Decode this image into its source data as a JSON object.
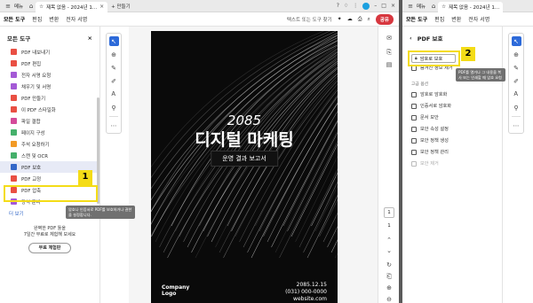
{
  "left": {
    "titlebar": {
      "menu_label": "메뉴",
      "tab_title": "제목 없음 - 2024년 1...",
      "new_tab": "+ 만들기"
    },
    "menubar": {
      "items": [
        "모든 도구",
        "편집",
        "변환",
        "전자 서명"
      ],
      "search_placeholder": "텍스트 또는 도구 찾기",
      "share_label": "공유"
    },
    "tools_panel": {
      "title": "모든 도구",
      "items": [
        {
          "label": "PDF 내보내기",
          "color": "#e94f43"
        },
        {
          "label": "PDF 편집",
          "color": "#e94f43"
        },
        {
          "label": "전자 서명 요청",
          "color": "#a45ad6"
        },
        {
          "label": "채우기 및 서명",
          "color": "#a45ad6"
        },
        {
          "label": "PDF 만들기",
          "color": "#e94f43"
        },
        {
          "label": "이 PDF 스타일화",
          "color": "#e94f43"
        },
        {
          "label": "파일 결합",
          "color": "#d44a9a"
        },
        {
          "label": "페이지 구성",
          "color": "#45b06b"
        },
        {
          "label": "주석 요청하기",
          "color": "#f29a25"
        },
        {
          "label": "스캔 및 OCR",
          "color": "#45b06b"
        },
        {
          "label": "PDF 보호",
          "color": "#3468c8"
        },
        {
          "label": "PDF 교정",
          "color": "#e94f43"
        },
        {
          "label": "PDF 압축",
          "color": "#e94f43"
        },
        {
          "label": "양식 준비",
          "color": "#a45ad6"
        }
      ],
      "more_link": "더 보기",
      "promo_line1": "완벽한 PDF 툴을",
      "promo_line2": "7일간 무료로 체험해 보세요",
      "trial_button": "무료 체험판"
    },
    "tooltip_text": "암호나 인증서로 PDF를 보호하거나 권한을 설정합니다.",
    "badge": "1",
    "document": {
      "year": "2085",
      "title": "디지털 마케팅",
      "subtitle": "운영 결과 보고서",
      "logo_line1": "Company",
      "logo_line2": "Logo",
      "date": "2085.12.15",
      "phone": "(031) 000-0000",
      "website": "website.com"
    },
    "page_number": "1",
    "page_total": "1"
  },
  "right": {
    "titlebar": {
      "menu_label": "메뉴",
      "tab_title": "제목 없음 - 2024년 1..."
    },
    "menubar": {
      "items": [
        "모든 도구",
        "편집",
        "변환",
        "전자 서명"
      ]
    },
    "panel_title": "PDF 보호",
    "password_button": "암호로 보호",
    "hidden_info": "숨겨진 정보 제거",
    "tooltip_text": "PDF를 열거나 그 내용을 복사 또는 인쇄할 때 암호 요청",
    "badge": "2",
    "advanced_section": "고급 옵션",
    "advanced_items": [
      {
        "label": "암호로 암호화",
        "disabled": false
      },
      {
        "label": "인증서로 암호화",
        "disabled": false
      },
      {
        "label": "문서 보안",
        "disabled": false
      },
      {
        "label": "보안 속성 설정",
        "disabled": false
      },
      {
        "label": "보안 정책 생성",
        "disabled": false
      },
      {
        "label": "보안 정책 관리",
        "disabled": false
      },
      {
        "label": "보안 제거",
        "disabled": true
      }
    ]
  }
}
